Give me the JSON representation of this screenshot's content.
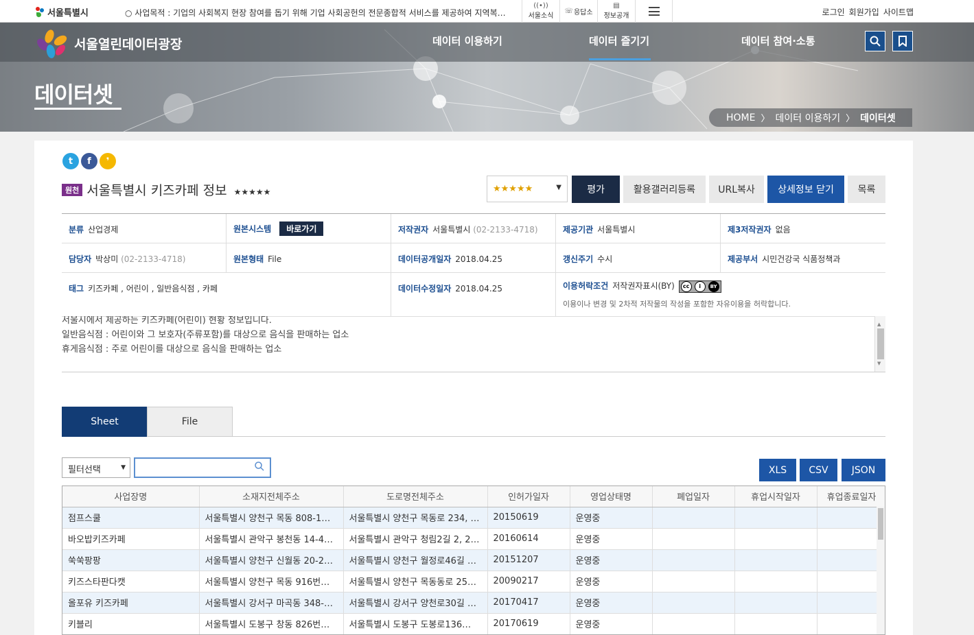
{
  "topbar": {
    "logo": "서울특별시",
    "notice": "○ 사업목적 : 기업의 사회복지 현장 참여를 돕기 위해 기업 사회공헌의 전문종합적 서비스를 제공하여 지역복지...",
    "icons": [
      {
        "label": "서울소식",
        "icon": "broadcast-icon"
      },
      {
        "label": "응답소",
        "icon": "chat-icon"
      },
      {
        "label": "정보공개",
        "icon": "document-icon"
      }
    ],
    "links": [
      "로그인",
      "회원가입",
      "사이트맵"
    ]
  },
  "header": {
    "brand": "서울열린데이터광장",
    "nav": [
      "데이터 이용하기",
      "데이터 즐기기",
      "데이터 참여·소통"
    ],
    "active_nav": "데이터 즐기기",
    "page_title": "데이터셋",
    "breadcrumb": [
      "HOME",
      "데이터 이용하기",
      "데이터셋"
    ]
  },
  "dataset": {
    "badge": "원천",
    "title": "서울특별시 키즈카페 정보",
    "stars": "★★★★★",
    "rating_select": "★★★★★",
    "buttons": [
      "평가",
      "활용갤러리등록",
      "URL복사",
      "상세정보 닫기",
      "목록"
    ],
    "info": {
      "category": {
        "k": "분류",
        "v": "산업경제"
      },
      "source_system": {
        "k": "원본시스템",
        "btn": "바로가기"
      },
      "copyright": {
        "k": "저작권자",
        "v": "서울특별시",
        "tel": "(02-2133-4718)"
      },
      "provider": {
        "k": "제공기관",
        "v": "서울특별시"
      },
      "third_party": {
        "k": "제3저작권자",
        "v": "없음"
      },
      "manager": {
        "k": "담당자",
        "v": "박상미",
        "tel": "(02-2133-4718)"
      },
      "source_type": {
        "k": "원본형태",
        "v": "File"
      },
      "open_date": {
        "k": "데이터공개일자",
        "v": "2018.04.25"
      },
      "cycle": {
        "k": "갱신주기",
        "v": "수시"
      },
      "department": {
        "k": "제공부서",
        "v": "시민건강국 식품정책과"
      },
      "tags": {
        "k": "태그",
        "v": "키즈카페 , 어린이 , 일반음식점 , 카페"
      },
      "modified_date": {
        "k": "데이터수정일자",
        "v": "2018.04.25"
      },
      "license": {
        "k": "이용허락조건",
        "v": "저작권자표시(BY)",
        "desc": "이용이나 변경 및 2차적 저작물의 작성을 포함한 자유이용을 허락합니다."
      }
    },
    "description": [
      "서울시에서 제공하는 키즈카페(어린이) 현황 정보입니다.",
      "일반음식점 : 어린이와 그 보호자(주류포함)를 대상으로 음식을 판매하는 업소",
      "휴게음식점 : 주로 어린이를 대상으로 음식을 판매하는 업소"
    ]
  },
  "tabs": [
    "Sheet",
    "File"
  ],
  "filter": {
    "select": "필터선택",
    "placeholder": ""
  },
  "downloads": [
    "XLS",
    "CSV",
    "JSON"
  ],
  "grid": {
    "columns": [
      "사업장명",
      "소재지전체주소",
      "도로명전체주소",
      "인허가일자",
      "영업상태명",
      "폐업일자",
      "휴업시작일자",
      "휴업종료일자"
    ],
    "rows": [
      [
        "점프스쿨",
        "서울특별시 양천구 목동 808-1…",
        "서울특별시 양천구 목동로 234, …",
        "20150619",
        "운영중",
        "",
        "",
        ""
      ],
      [
        "바오밥키즈카페",
        "서울특별시 관악구 봉천동 14-4…",
        "서울특별시 관악구 청림2길 2, 2…",
        "20160614",
        "운영중",
        "",
        "",
        ""
      ],
      [
        "쑥쑥팡팡",
        "서울특별시 양천구 신월동 20-2…",
        "서울특별시 양천구 월정로46길 …",
        "20151207",
        "운영중",
        "",
        "",
        ""
      ],
      [
        "키즈스타판다캣",
        "서울특별시 양천구 목동 916번…",
        "서울특별시 양천구 목동동로 25…",
        "20090217",
        "운영중",
        "",
        "",
        ""
      ],
      [
        "올포유 키즈카페",
        "서울특별시 강서구 마곡동 348-…",
        "서울특별시 강서구 양천로30길 …",
        "20170417",
        "운영중",
        "",
        "",
        ""
      ],
      [
        "키블리",
        "서울특별시 도봉구 창동 826번…",
        "서울특별시 도봉구 도봉로136…",
        "20170619",
        "운영중",
        "",
        "",
        ""
      ]
    ]
  }
}
